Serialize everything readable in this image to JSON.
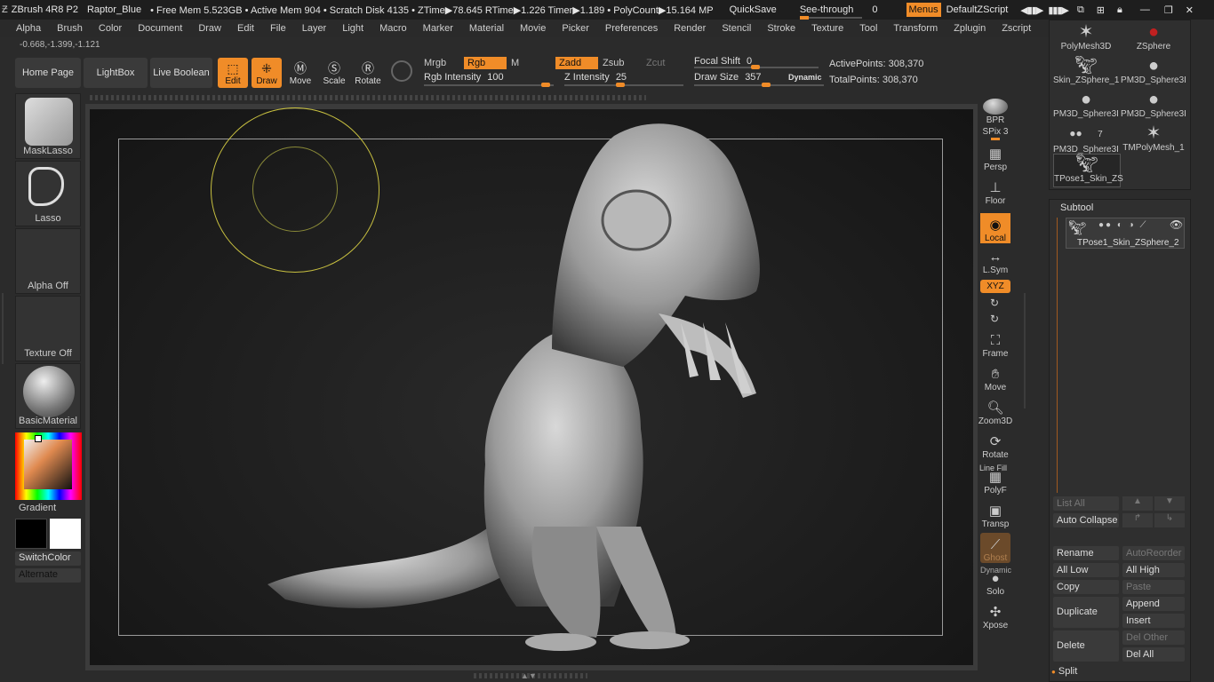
{
  "titlebar": {
    "app": "ZBrush 4R8 P2",
    "doc": "Raptor_Blue",
    "stats": "• Free Mem 5.523GB • Active Mem 904 • Scratch Disk 4135 • ZTime▶78.645 RTime▶1.226 Timer▶1.189 • PolyCount▶15.164 MP",
    "quicksave": "QuickSave",
    "seethrough_label": "See-through",
    "seethrough_value": "0",
    "menus": "Menus",
    "zscript": "DefaultZScript"
  },
  "menu": [
    "Alpha",
    "Brush",
    "Color",
    "Document",
    "Draw",
    "Edit",
    "File",
    "Layer",
    "Light",
    "Macro",
    "Marker",
    "Material",
    "Movie",
    "Picker",
    "Preferences",
    "Render",
    "Stencil",
    "Stroke",
    "Texture",
    "Tool",
    "Transform",
    "Zplugin",
    "Zscript"
  ],
  "coords": "-0.668,-1.399,-1.121",
  "toolbar": {
    "home": "Home Page",
    "lightbox": "LightBox",
    "liveboolean": "Live Boolean",
    "edit": "Edit",
    "draw": "Draw",
    "move": "Move",
    "scale": "Scale",
    "rotate": "Rotate",
    "mrgb": "Mrgb",
    "rgb": "Rgb",
    "m": "M",
    "zadd": "Zadd",
    "zsub": "Zsub",
    "zcut": "Zcut",
    "rgb_intensity_label": "Rgb Intensity",
    "rgb_intensity": "100",
    "z_intensity_label": "Z Intensity",
    "z_intensity": "25",
    "focal_label": "Focal Shift",
    "focal": "0",
    "drawsize_label": "Draw Size",
    "drawsize": "357",
    "dynamic": "Dynamic",
    "active_points": "ActivePoints: 308,370",
    "total_points": "TotalPoints: 308,370"
  },
  "left": {
    "brush1": "MaskLasso",
    "brush2": "Lasso",
    "alpha": "Alpha Off",
    "texture": "Texture Off",
    "material": "BasicMaterial",
    "gradient": "Gradient",
    "switchcolor": "SwitchColor",
    "alternate": "Alternate"
  },
  "right": {
    "bpr": "BPR",
    "spix": "SPix 3",
    "persp": "Persp",
    "floor": "Floor",
    "local": "Local",
    "lsym": "L.Sym",
    "xyz": "XYZ",
    "frame": "Frame",
    "move": "Move",
    "zoom": "Zoom3D",
    "rotate": "Rotate",
    "polyf": "PolyF",
    "linefill": "Line Fill",
    "transp": "Transp",
    "ghost": "Ghost",
    "dynamic": "Dynamic",
    "solo": "Solo",
    "xpose": "Xpose"
  },
  "tools": [
    {
      "name": "PolyMesh3D",
      "icon": "star-icon"
    },
    {
      "name": "ZSphere",
      "icon": "red-sphere-icon"
    },
    {
      "name": "Skin_ZSphere_1",
      "icon": "figure-icon"
    },
    {
      "name": "PM3D_Sphere3I",
      "icon": "sphere-icon"
    },
    {
      "name": "PM3D_Sphere3I",
      "icon": "sphere-icon"
    },
    {
      "name": "PM3D_Sphere3I",
      "icon": "sphere-icon"
    },
    {
      "name": "PM3D_Sphere3I",
      "icon": "pair-icon"
    },
    {
      "name": "TMPolyMesh_1",
      "icon": "star-icon"
    },
    {
      "name": "TPose1_Skin_ZS",
      "icon": "figure-icon"
    }
  ],
  "tool_count": "7",
  "subtool": {
    "title": "Subtool",
    "item": "TPose1_Skin_ZSphere_2",
    "listall": "List All",
    "autocollapse": "Auto Collapse",
    "rename": "Rename",
    "autoreorder": "AutoReorder",
    "alllow": "All Low",
    "allhigh": "All High",
    "copy": "Copy",
    "paste": "Paste",
    "duplicate": "Duplicate",
    "append": "Append",
    "insert": "Insert",
    "delete": "Delete",
    "delother": "Del Other",
    "delall": "Del All",
    "split": "Split"
  },
  "colors": {
    "accent": "#f08c28",
    "bg": "#2b2b2b",
    "panel": "#333333"
  }
}
